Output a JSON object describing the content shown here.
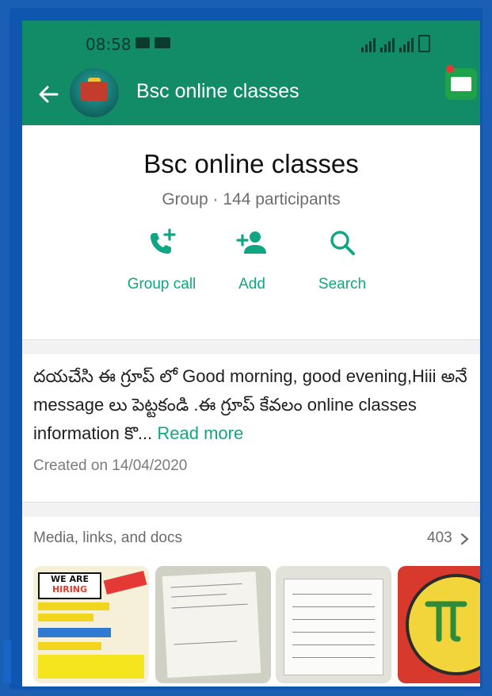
{
  "status_bar": {
    "time": "08:58"
  },
  "app_bar": {
    "title": "Bsc online classes"
  },
  "group": {
    "name": "Bsc online classes",
    "subtitle": "Group · 144 participants",
    "actions": [
      {
        "label": "Group call",
        "icon": "add-call-icon"
      },
      {
        "label": "Add",
        "icon": "add-person-icon"
      },
      {
        "label": "Search",
        "icon": "search-icon"
      }
    ]
  },
  "description": {
    "text": "దయచేసి ఈ గ్రూప్ లో Good morning, good evening,Hiii అనే message లు పెట్టకండి .ఈ గ్రూప్ కేవలం online classes information కొ...",
    "read_more": "Read more",
    "created": "Created on 14/04/2020"
  },
  "media": {
    "title": "Media, links, and docs",
    "count": "403",
    "thumb1_banner_line1": "WE ARE",
    "thumb1_banner_line2": "HIRING"
  },
  "colors": {
    "app_bar": "#128c66",
    "accent": "#11a683",
    "frame": "#0e56b0"
  }
}
